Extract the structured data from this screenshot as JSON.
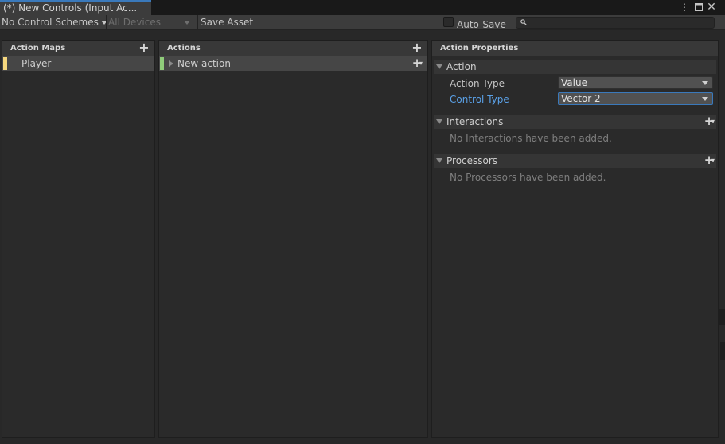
{
  "window": {
    "tab_title": "(*) New Controls (Input Ac...",
    "menu_icon": "kebab-menu-icon",
    "maximize_icon": "maximize-icon",
    "close_icon": "close-icon"
  },
  "toolbar": {
    "control_schemes": "No Control Schemes",
    "devices": "All Devices",
    "save_asset": "Save Asset",
    "auto_save_label": "Auto-Save",
    "auto_save_checked": false,
    "search_placeholder": ""
  },
  "action_maps": {
    "header": "Action Maps",
    "items": [
      {
        "label": "Player",
        "color": "#f5d77e"
      }
    ]
  },
  "actions": {
    "header": "Actions",
    "items": [
      {
        "label": "New action",
        "color": "#8fcc7a"
      }
    ]
  },
  "properties": {
    "header": "Action Properties",
    "action_section": "Action",
    "action_type_label": "Action Type",
    "action_type_value": "Value",
    "control_type_label": "Control Type",
    "control_type_value": "Vector 2",
    "interactions_section": "Interactions",
    "interactions_empty": "No Interactions have been added.",
    "processors_section": "Processors",
    "processors_empty": "No Processors have been added."
  },
  "colors": {
    "accent": "#3a79bb",
    "focused_label": "#5aa0e6"
  }
}
